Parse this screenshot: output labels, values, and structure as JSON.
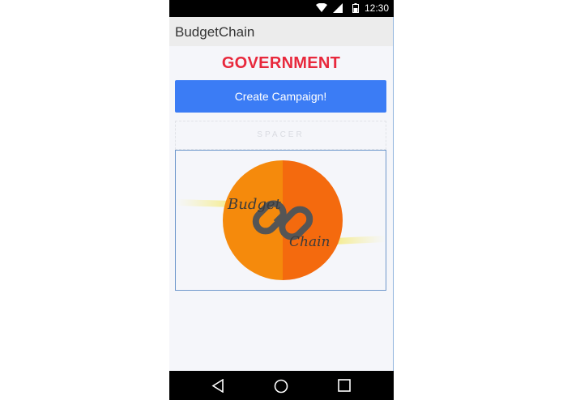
{
  "status_bar": {
    "time": "12:30",
    "icons": [
      "wifi-icon",
      "signal-icon",
      "battery-icon"
    ]
  },
  "app_bar": {
    "title": "BudgetChain"
  },
  "main": {
    "heading": "GOVERNMENT",
    "create_button_label": "Create Campaign!",
    "spacer_label": "SPACER",
    "logo": {
      "word_top": "Budget",
      "word_bottom": "Chain",
      "icon": "chain-link-icon"
    }
  },
  "nav_bar": {
    "icons": [
      "back-icon",
      "home-icon",
      "recents-icon"
    ]
  },
  "colors": {
    "heading": "#e8283c",
    "button": "#3b7cf5",
    "logo_orange_left": "#f58a0c",
    "logo_orange_right": "#f46a0e"
  }
}
